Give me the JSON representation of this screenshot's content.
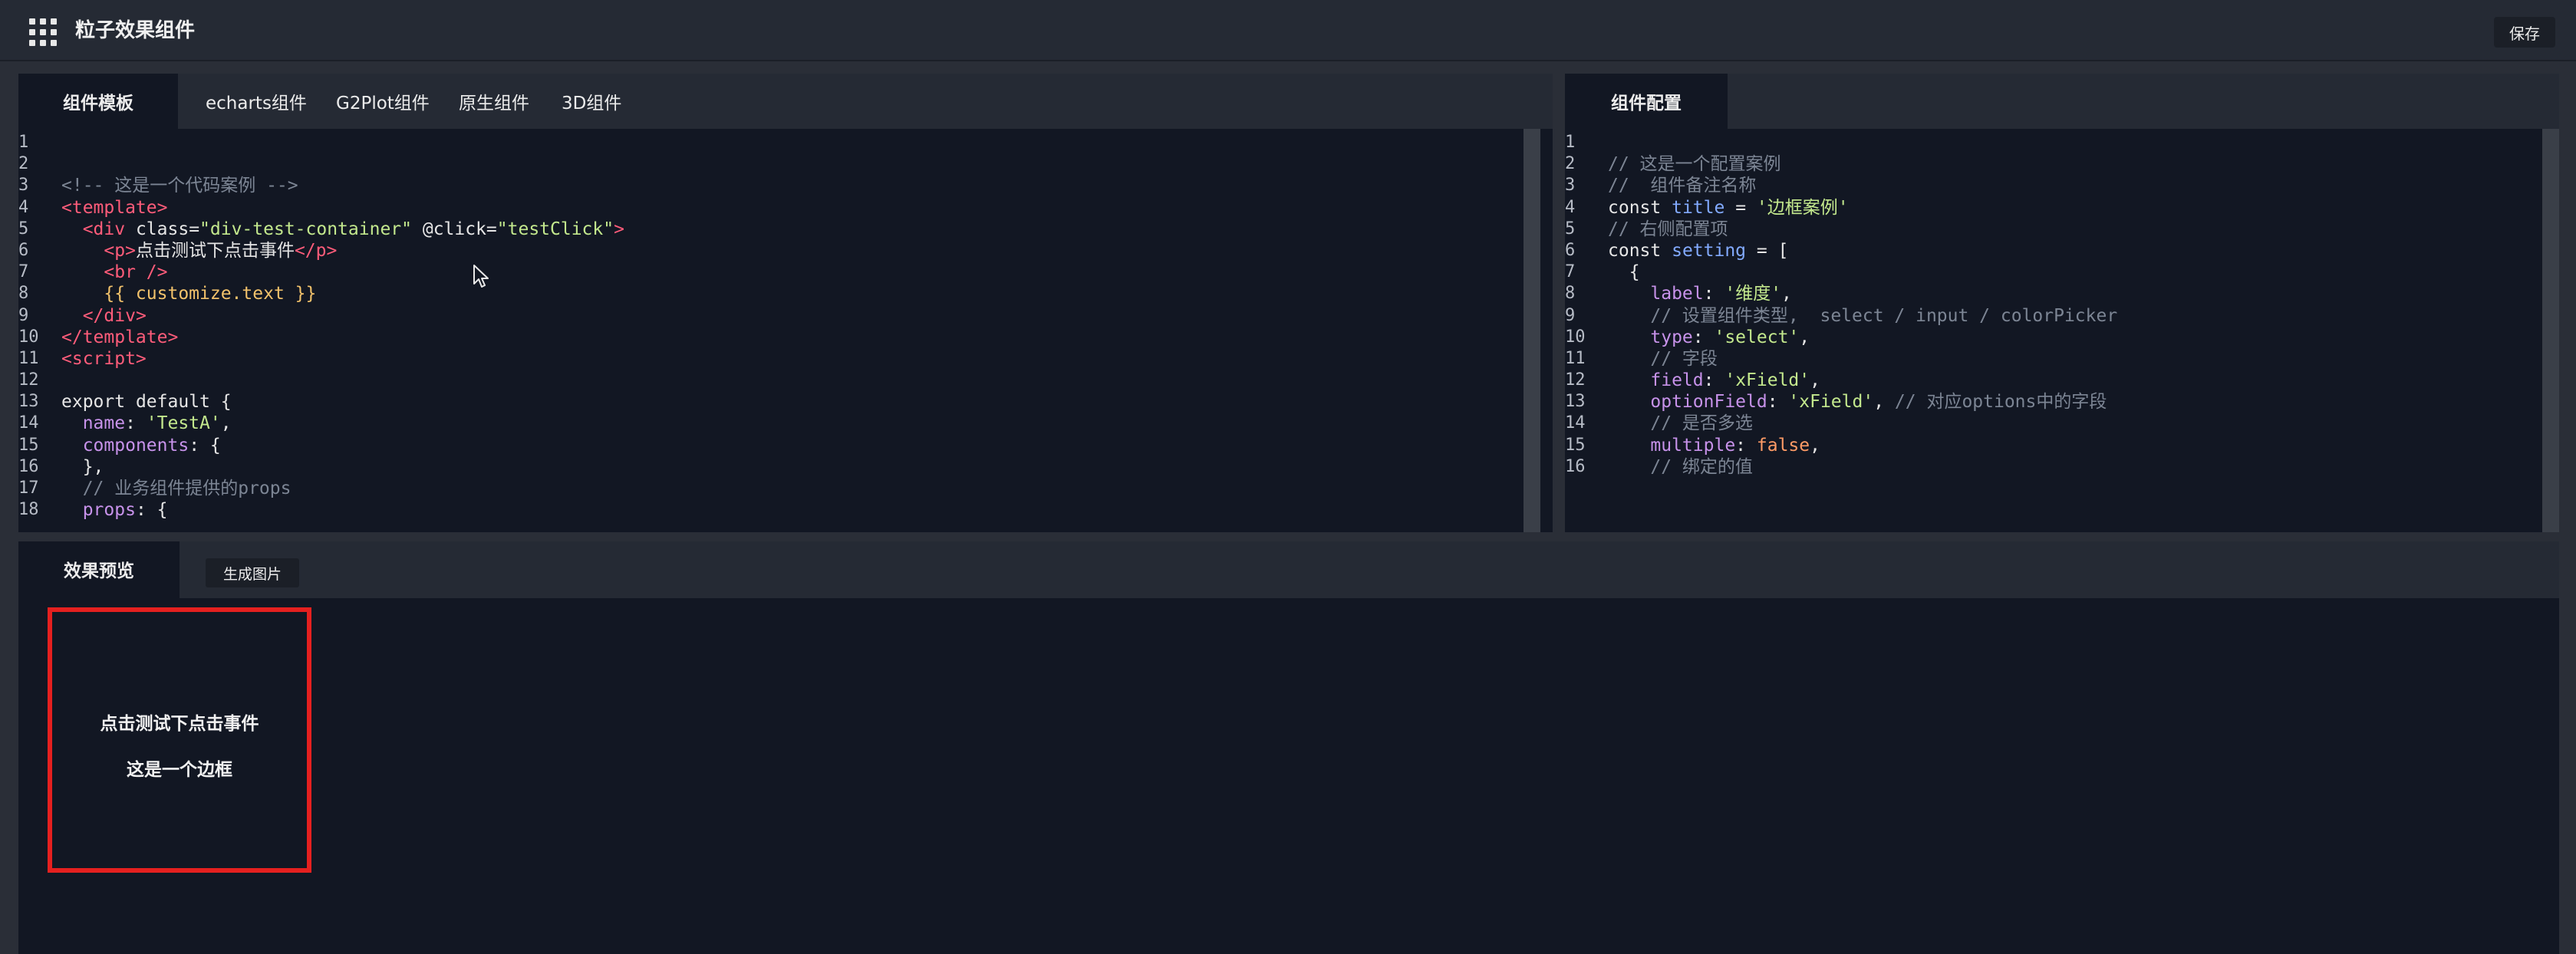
{
  "header": {
    "title": "粒子效果组件",
    "save_label": "保存",
    "menu_icon": "apps-grid-icon"
  },
  "template_panel": {
    "tabs": [
      {
        "label": "组件模板",
        "active": true
      },
      {
        "label": "echarts组件",
        "active": false
      },
      {
        "label": "G2Plot组件",
        "active": false
      },
      {
        "label": "原生组件",
        "active": false
      },
      {
        "label": "3D组件",
        "active": false
      }
    ],
    "lines": [
      {
        "n": "1",
        "text": ""
      },
      {
        "n": "2",
        "text": ""
      },
      {
        "n": "3",
        "text": "<!-- 这是一个代码案例 -->"
      },
      {
        "n": "4",
        "text": "<template>"
      },
      {
        "n": "5",
        "text": "  <div class=\"div-test-container\" @click=\"testClick\">"
      },
      {
        "n": "6",
        "text": "    <p>点击测试下点击事件</p>"
      },
      {
        "n": "7",
        "text": "    <br />"
      },
      {
        "n": "8",
        "text": "    {{ customize.text }}"
      },
      {
        "n": "9",
        "text": "  </div>"
      },
      {
        "n": "10",
        "text": "</template>"
      },
      {
        "n": "11",
        "text": "<script>"
      },
      {
        "n": "12",
        "text": ""
      },
      {
        "n": "13",
        "text": "export default {"
      },
      {
        "n": "14",
        "text": "  name: 'TestA',"
      },
      {
        "n": "15",
        "text": "  components: {"
      },
      {
        "n": "16",
        "text": "  },"
      },
      {
        "n": "17",
        "text": "  // 业务组件提供的props"
      },
      {
        "n": "18",
        "text": "  props: {"
      }
    ]
  },
  "config_panel": {
    "tab_label": "组件配置",
    "lines": [
      {
        "n": "1",
        "text": ""
      },
      {
        "n": "2",
        "text": "// 这是一个配置案例"
      },
      {
        "n": "3",
        "text": "//  组件备注名称"
      },
      {
        "n": "4",
        "text": "const title = '边框案例'"
      },
      {
        "n": "5",
        "text": "// 右侧配置项"
      },
      {
        "n": "6",
        "text": "const setting = ["
      },
      {
        "n": "7",
        "text": "  {"
      },
      {
        "n": "8",
        "text": "    label: '维度',"
      },
      {
        "n": "9",
        "text": "    // 设置组件类型,  select / input / colorPicker"
      },
      {
        "n": "10",
        "text": "    type: 'select',"
      },
      {
        "n": "11",
        "text": "    // 字段"
      },
      {
        "n": "12",
        "text": "    field: 'xField',"
      },
      {
        "n": "13",
        "text": "    optionField: 'xField', // 对应options中的字段"
      },
      {
        "n": "14",
        "text": "    // 是否多选"
      },
      {
        "n": "15",
        "text": "    multiple: false,"
      },
      {
        "n": "16",
        "text": "    // 绑定的值"
      }
    ]
  },
  "preview_panel": {
    "tab_label": "效果预览",
    "generate_label": "生成图片",
    "box_line1": "点击测试下点击事件",
    "box_line2": "这是一个边框",
    "border_color": "#e5201f"
  },
  "colors": {
    "background": "#121723",
    "chrome": "#252a34",
    "tag": "#ff5c7a",
    "string": "#c3e88d",
    "comment": "#7c8594",
    "property": "#c792ea",
    "interpolation": "#f2c26b"
  }
}
